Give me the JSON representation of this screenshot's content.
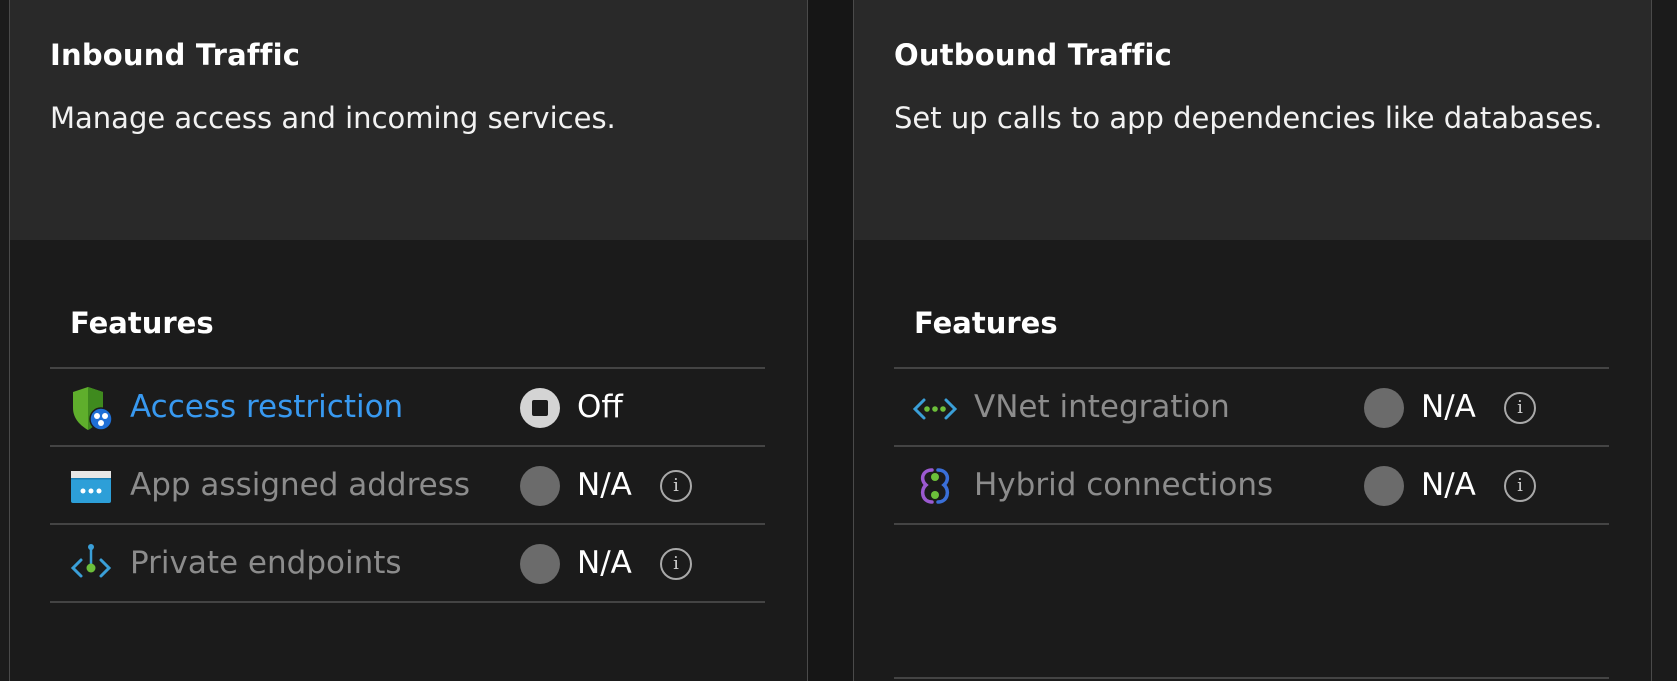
{
  "inbound": {
    "title": "Inbound Traffic",
    "description": "Manage access and incoming services.",
    "features_title": "Features",
    "rows": [
      {
        "label": "Access restriction",
        "status": "Off",
        "icon": "shield-globe-icon"
      },
      {
        "label": "App assigned address",
        "status": "N/A",
        "icon": "app-window-icon"
      },
      {
        "label": "Private endpoints",
        "status": "N/A",
        "icon": "private-endpoint-icon"
      }
    ]
  },
  "outbound": {
    "title": "Outbound Traffic",
    "description": "Set up calls to app dependencies like databases.",
    "features_title": "Features",
    "rows": [
      {
        "label": "VNet integration",
        "status": "N/A",
        "icon": "vnet-icon"
      },
      {
        "label": "Hybrid connections",
        "status": "N/A",
        "icon": "hybrid-connection-icon"
      }
    ]
  },
  "info_glyph": "i",
  "colors": {
    "link": "#3899f0",
    "card_header_bg": "#292929",
    "page_bg": "#1b1b1b",
    "disabled_text": "#8c8c8c"
  }
}
